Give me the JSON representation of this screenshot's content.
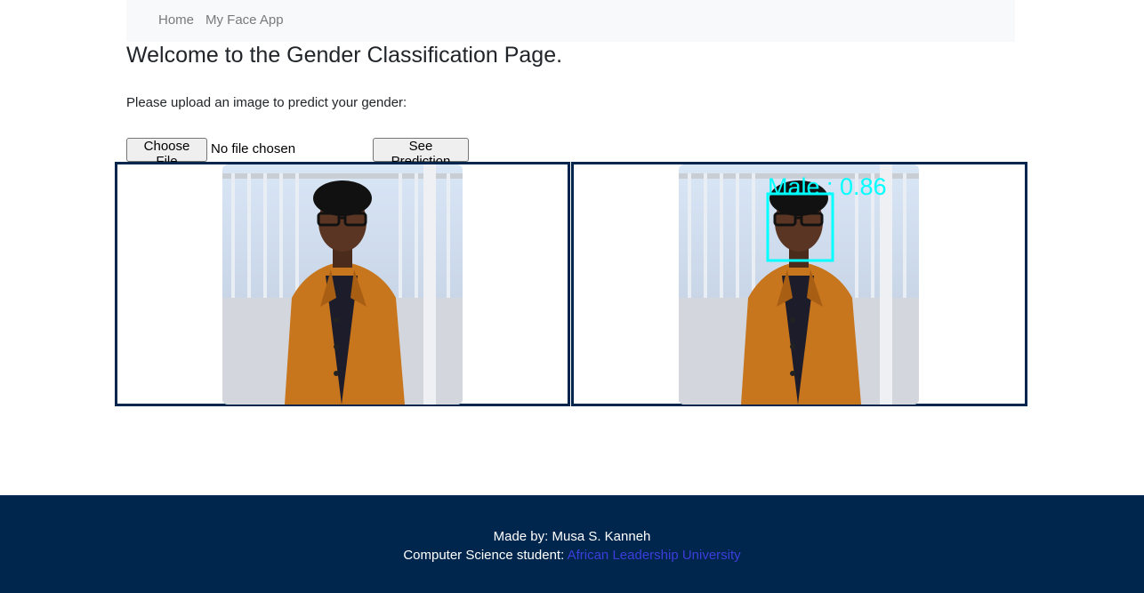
{
  "nav": {
    "home_label": "Home",
    "app_label": "My Face App"
  },
  "page": {
    "title": "Welcome to the Gender Classification Page.",
    "instructions": "Please upload an image to predict your gender:"
  },
  "form": {
    "choose_file_label": "Choose File",
    "file_status": "No file chosen",
    "submit_label": "See Prediction"
  },
  "prediction": {
    "label": "Male : 0.86",
    "box_color": "#00ffff"
  },
  "footer": {
    "made_by": "Made by: Musa S. Kanneh",
    "student_prefix": "Computer Science student: ",
    "university_link": "African Leadership University"
  },
  "colors": {
    "brand_dark": "#00264d",
    "link": "#3d3ddb"
  }
}
